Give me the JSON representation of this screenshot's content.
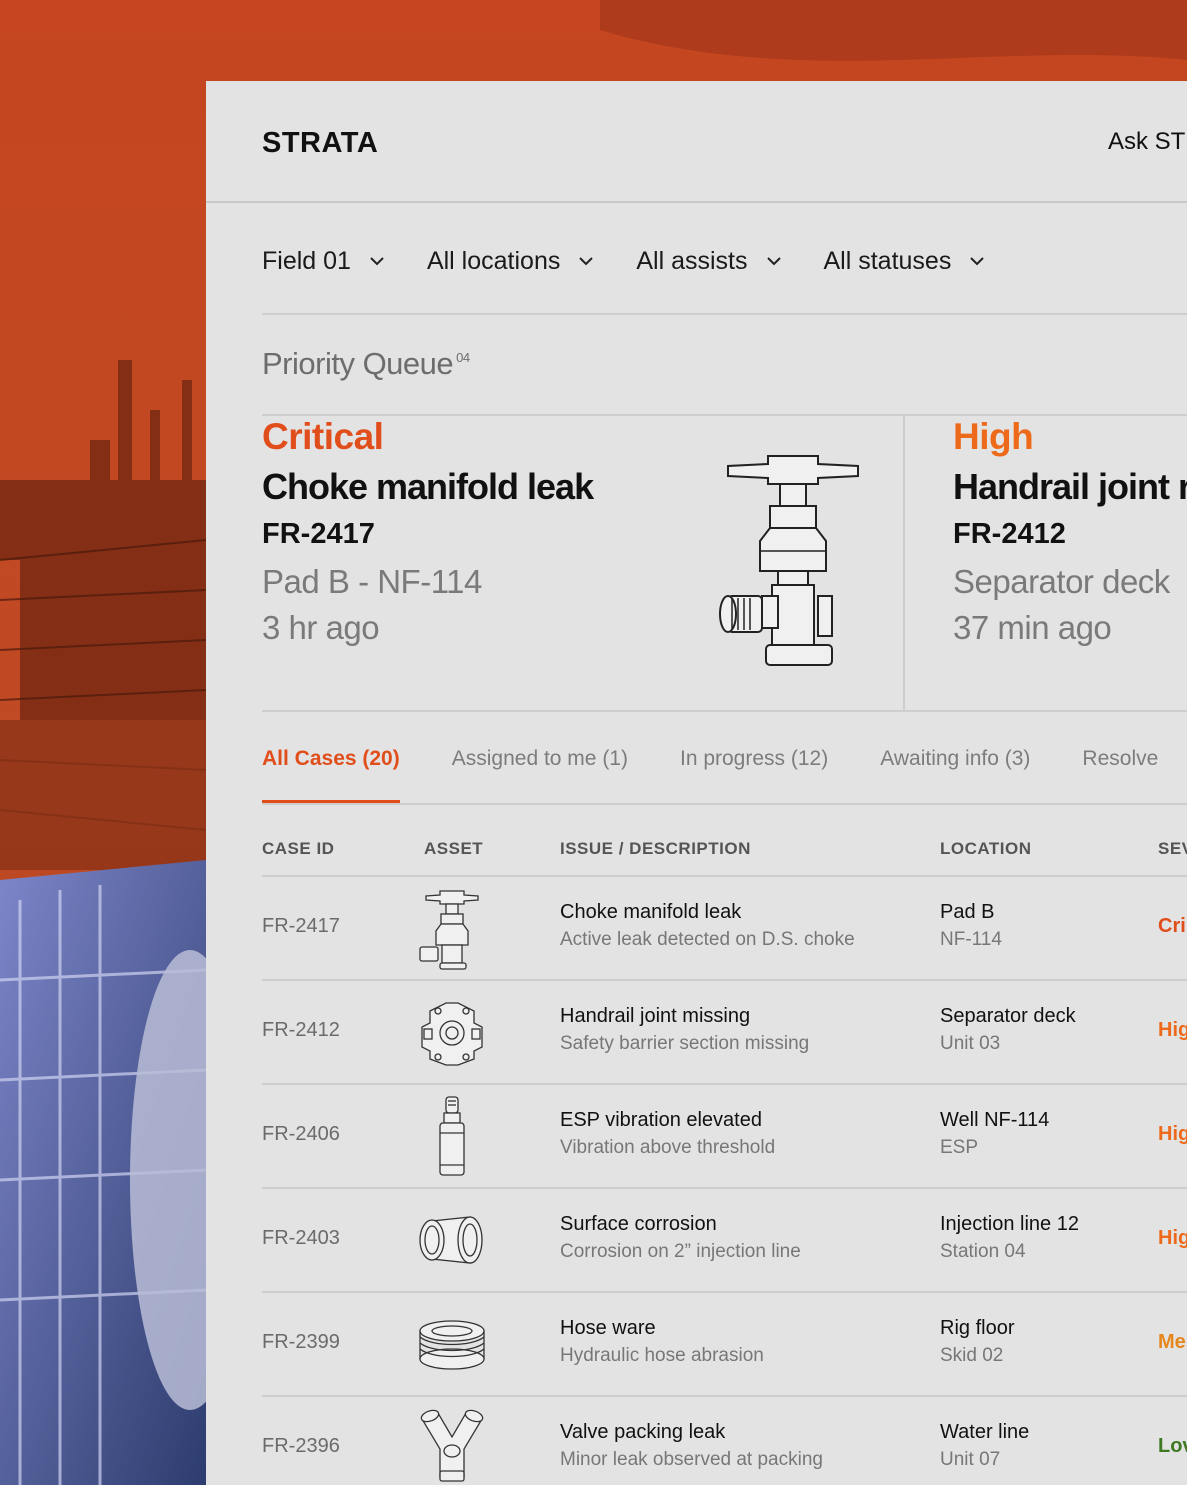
{
  "app": {
    "logo": "STRATA",
    "ask_label": "Ask ST"
  },
  "filters": [
    {
      "label": "Field 01"
    },
    {
      "label": "All locations"
    },
    {
      "label": "All assists"
    },
    {
      "label": "All statuses"
    }
  ],
  "priority_queue": {
    "title": "Priority Queue",
    "count": "04"
  },
  "cards": [
    {
      "severity": "Critical",
      "title": "Choke manifold leak",
      "id": "FR-2417",
      "location": "Pad B - NF-114",
      "time": "3 hr ago"
    },
    {
      "severity": "High",
      "title": "Handrail joint r",
      "id": "FR-2412",
      "location": "Separator deck",
      "time": "37 min ago"
    }
  ],
  "tabs": [
    {
      "label": "All Cases (20)",
      "active": true
    },
    {
      "label": "Assigned to me (1)"
    },
    {
      "label": "In progress (12)"
    },
    {
      "label": "Awaiting info (3)"
    },
    {
      "label": "Resolve"
    }
  ],
  "table": {
    "headers": [
      "CASE ID",
      "ASSET",
      "ISSUE / DESCRIPTION",
      "LOCATION",
      "SEV"
    ],
    "rows": [
      {
        "id": "FR-2417",
        "asset_icon": "valve-icon",
        "title": "Choke manifold leak",
        "desc": "Active leak detected on D.S. choke",
        "loc": "Pad B",
        "loc_sub": "NF-114",
        "sev": "Cri",
        "sev_color": "#e04e1b"
      },
      {
        "id": "FR-2412",
        "asset_icon": "handrail-joint-icon",
        "title": "Handrail joint missing",
        "desc": "Safety barrier section missing",
        "loc": "Separator deck",
        "loc_sub": "Unit 03",
        "sev": "Hig",
        "sev_color": "#ec6a1a"
      },
      {
        "id": "FR-2406",
        "asset_icon": "esp-pump-icon",
        "title": "ESP vibration elevated",
        "desc": "Vibration above threshold",
        "loc": "Well NF-114",
        "loc_sub": "ESP",
        "sev": "Hig",
        "sev_color": "#ec6a1a"
      },
      {
        "id": "FR-2403",
        "asset_icon": "pipe-coupling-icon",
        "title": "Surface corrosion",
        "desc": "Corrosion on 2” injection line",
        "loc": "Injection line 12",
        "loc_sub": "Station 04",
        "sev": "Hig",
        "sev_color": "#ec6a1a"
      },
      {
        "id": "FR-2399",
        "asset_icon": "hose-coil-icon",
        "title": "Hose ware",
        "desc": "Hydraulic hose abrasion",
        "loc": "Rig floor",
        "loc_sub": "Skid 02",
        "sev": "Me",
        "sev_color": "#e6871e"
      },
      {
        "id": "FR-2396",
        "asset_icon": "wye-fitting-icon",
        "title": "Valve packing leak",
        "desc": "Minor leak observed at packing",
        "loc": "Water line",
        "loc_sub": "Unit 07",
        "sev": "Lov",
        "sev_color": "#3f7a23"
      }
    ]
  }
}
